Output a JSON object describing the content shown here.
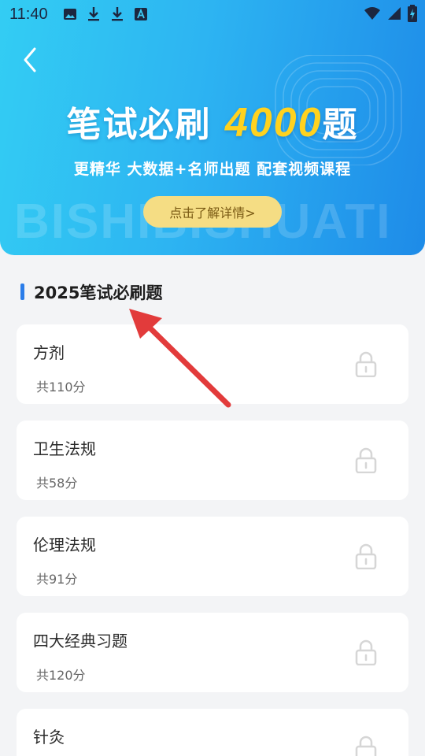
{
  "status_bar": {
    "time": "11:40"
  },
  "banner": {
    "title_prefix": "笔试必刷",
    "title_number": "4000",
    "title_suffix": "题",
    "subtitle": "更精华 大数据+名师出题 配套视频课程",
    "watermark": "BISHIBISHUATI",
    "detail_button": "点击了解详情>"
  },
  "section": {
    "title": "2025笔试必刷题"
  },
  "cards": [
    {
      "title": "方剂",
      "subtitle": "共110分"
    },
    {
      "title": "卫生法规",
      "subtitle": "共58分"
    },
    {
      "title": "伦理法规",
      "subtitle": "共91分"
    },
    {
      "title": "四大经典习题",
      "subtitle": "共120分"
    },
    {
      "title": "针灸",
      "subtitle": ""
    }
  ],
  "colors": {
    "accent": "#2b7de9",
    "banner_start": "#33cdf3",
    "banner_end": "#1e8be8",
    "highlight": "#ffd21f",
    "detail_button_bg": "#f5dd84",
    "annotation_arrow": "#e23b3b"
  },
  "icons": {
    "back": "chevron-left-icon",
    "lock": "lock-icon",
    "image": "image-icon",
    "download": "download-icon",
    "font": "font-a-icon",
    "wifi": "wifi-icon",
    "signal": "signal-icon",
    "battery": "battery-charging-icon"
  }
}
